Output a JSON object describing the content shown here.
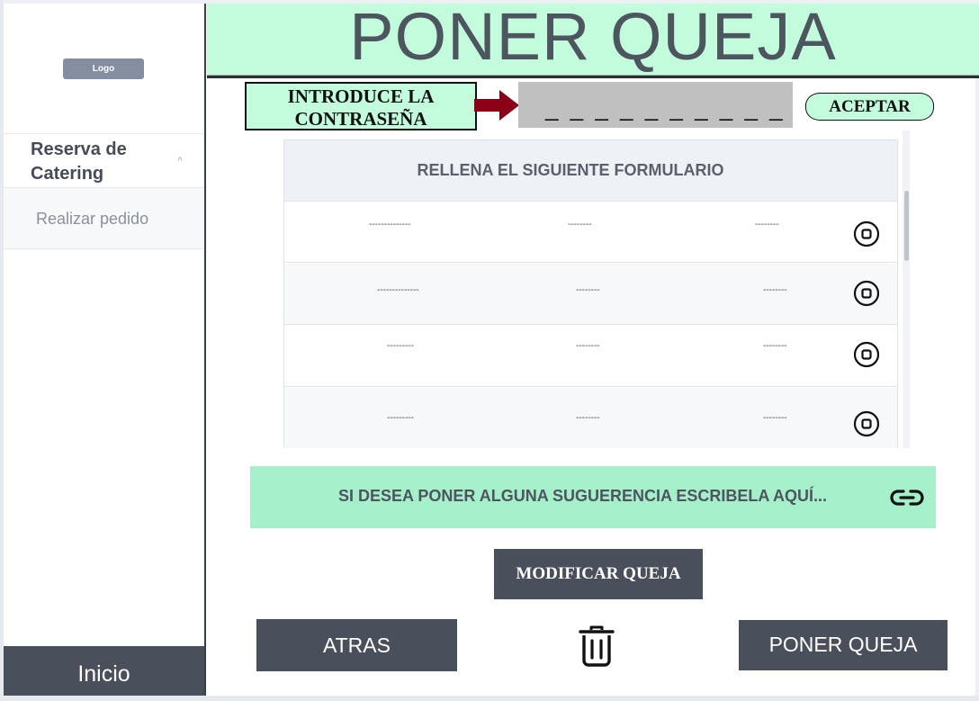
{
  "sidebar": {
    "logo_label": "Logo",
    "menu_group": "Reserva de Catering",
    "menu_items": [
      "Realizar pedido"
    ],
    "home_button": "Inicio"
  },
  "header": {
    "title": "PONER QUEJA"
  },
  "password": {
    "label": "INTRODUCE LA CONTRASEÑA",
    "value": "_ _ _ _ _ _ _ _ _ _ _",
    "accept_label": "ACEPTAR"
  },
  "form": {
    "title": "RELLENA EL SIGUIENTE FORMULARIO",
    "rows": [
      [
        "--------------",
        "--------",
        "--------"
      ],
      [
        "--------------",
        "--------",
        "--------"
      ],
      [
        "---------",
        "--------",
        "--------"
      ],
      [
        "---------",
        "--------",
        "--------"
      ]
    ]
  },
  "suggestion": {
    "placeholder": "SI DESEA PONER ALGUNA SUGUERENCIA ESCRIBELA AQUÍ..."
  },
  "actions": {
    "modify_label": "MODIFICAR QUEJA",
    "back_label": "ATRAS",
    "submit_label": "PONER QUEJA"
  },
  "colors": {
    "mint": "#c3fbdd",
    "mint_dark": "#a6efcb",
    "button_gray": "#4a505b",
    "arrow_red": "#8b0016"
  }
}
